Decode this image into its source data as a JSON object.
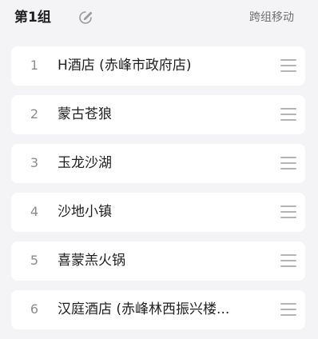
{
  "header": {
    "group_title": "第1组",
    "move_label": "跨组移动",
    "edit_icon": "edit-pencil-icon"
  },
  "items": [
    {
      "index": "1",
      "name": "H酒店 (赤峰市政府店)"
    },
    {
      "index": "2",
      "name": "蒙古苍狼"
    },
    {
      "index": "3",
      "name": "玉龙沙湖"
    },
    {
      "index": "4",
      "name": "沙地小镇"
    },
    {
      "index": "5",
      "name": "喜蒙羔火锅"
    },
    {
      "index": "6",
      "name": "汉庭酒店 (赤峰林西振兴楼..."
    }
  ],
  "colors": {
    "background": "#f4f4f6",
    "card": "#ffffff",
    "primary_text": "#1f1f1f",
    "secondary_text": "#8c8c8c",
    "handle": "#b4b4b4"
  }
}
